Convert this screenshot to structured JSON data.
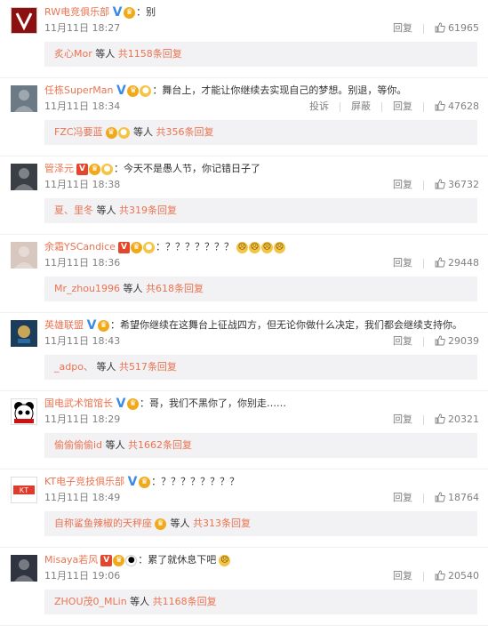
{
  "labels": {
    "reply": "回复",
    "report": "投诉",
    "block": "屏蔽",
    "etc": "等人",
    "replies_prefix": "共",
    "replies_suffix": "条回复"
  },
  "colors": {
    "accent": "#eb7350",
    "muted": "#808080",
    "sub_bg": "#f2f2f5"
  },
  "comments": [
    {
      "username": "RW电竞俱乐部",
      "badges": [
        "verified-v-icon",
        "fan-badge-icon"
      ],
      "text": "：别",
      "time": "11月11日 18:27",
      "likes": "61965",
      "show_report": false,
      "avatar_icon": "rw-logo",
      "reply_user": "炙心Mor",
      "reply_count": "1158"
    },
    {
      "username": "任栋SuperMan",
      "badges": [
        "verified-v-icon",
        "fan-badge-icon",
        "gold-medal-icon"
      ],
      "text": "：舞台上，才能让你继续去实现自己的梦想。别退，等你。",
      "time": "11月11日 18:34",
      "likes": "47628",
      "show_report": true,
      "avatar_icon": "person-photo",
      "reply_user": "FZC冯要蓝",
      "reply_user_badges": [
        "fan-badge-icon",
        "gold-medal-icon"
      ],
      "reply_count": "356"
    },
    {
      "username": "管泽元",
      "badges": [
        "vip-v-icon",
        "fan-badge-icon",
        "gold-medal-icon"
      ],
      "text": "：今天不是愚人节，你记错日子了",
      "time": "11月11日 18:38",
      "likes": "36732",
      "show_report": false,
      "avatar_icon": "person-photo",
      "reply_user": "夏、里冬",
      "reply_count": "319"
    },
    {
      "username": "余霜YSCandice",
      "badges": [
        "vip-v-icon",
        "fan-badge-icon",
        "gold-medal-icon"
      ],
      "text": "：？？？？？？？",
      "emoji_tail": [
        "crying-emoji-icon",
        "crying-emoji-icon",
        "crying-emoji-icon",
        "crying-emoji-icon"
      ],
      "time": "11月11日 18:36",
      "likes": "29448",
      "show_report": false,
      "avatar_icon": "person-photo",
      "reply_user": "Mr_zhou1996",
      "reply_count": "618"
    },
    {
      "username": "英雄联盟",
      "badges": [
        "verified-v-icon",
        "fan-badge-icon"
      ],
      "text": "：希望你继续在这舞台上征战四方，但无论你做什么决定，我们都会继续支持你。",
      "time": "11月11日 18:43",
      "likes": "29039",
      "show_report": false,
      "avatar_icon": "lol-logo",
      "reply_user": "_adpo、",
      "reply_count": "517"
    },
    {
      "username": "国电武术馆馆长",
      "badges": [
        "verified-v-icon",
        "fan-badge-icon"
      ],
      "text": "：哥，我们不黑你了，你别走……",
      "time": "11月11日 18:29",
      "likes": "20321",
      "show_report": false,
      "avatar_icon": "panda-logo",
      "reply_user": "偷偷偷偷id",
      "reply_count": "1662"
    },
    {
      "username": "KT电子竞技俱乐部",
      "badges": [
        "verified-v-icon",
        "fan-badge-icon"
      ],
      "text": "：？？？？？？？？",
      "time": "11月11日 18:49",
      "likes": "18764",
      "show_report": false,
      "avatar_icon": "kt-logo",
      "reply_user": "自称鲨鱼辣椒的天秤座",
      "reply_user_badges": [
        "fan-badge-icon"
      ],
      "reply_count": "313"
    },
    {
      "username": "Misaya若风",
      "badges": [
        "vip-v-icon",
        "fan-badge-icon",
        "panda-badge-icon"
      ],
      "text": "：累了就休息下吧",
      "emoji_tail": [
        "crying-emoji-icon"
      ],
      "time": "11月11日 19:06",
      "likes": "20540",
      "show_report": false,
      "avatar_icon": "person-photo",
      "reply_user": "ZHOU茂0_MLin",
      "reply_count": "1168"
    }
  ]
}
